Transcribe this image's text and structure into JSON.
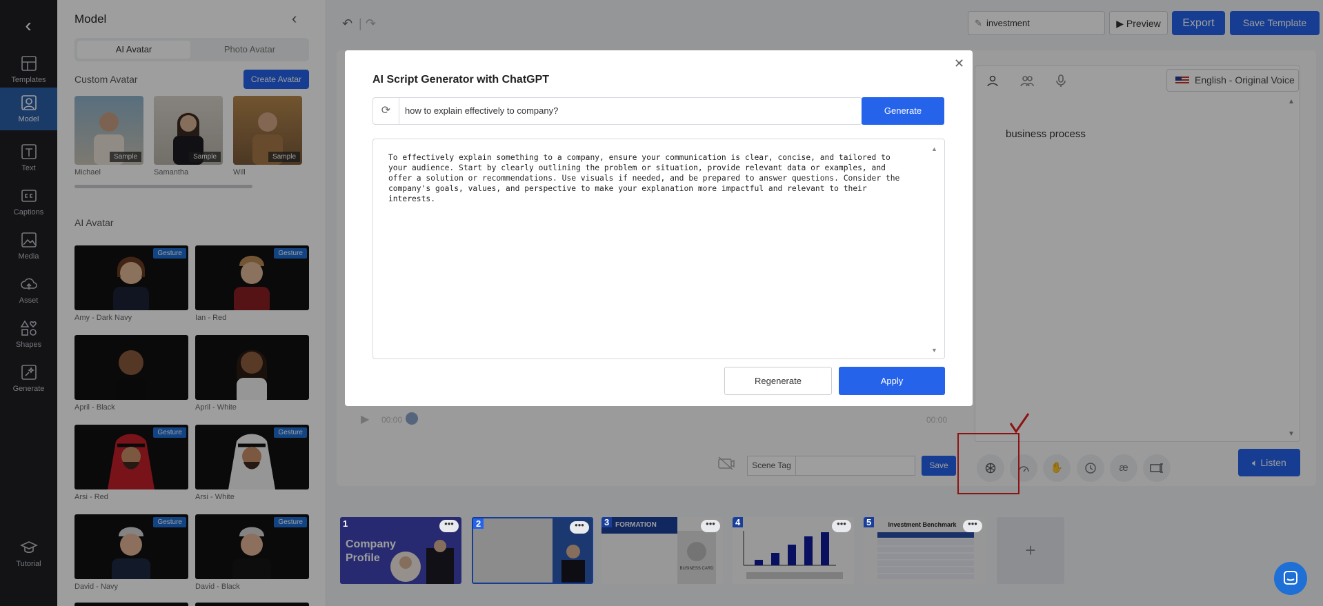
{
  "rail": {
    "items": [
      {
        "label": "Templates",
        "icon": "templates-icon"
      },
      {
        "label": "Model",
        "icon": "model-icon"
      },
      {
        "label": "Text",
        "icon": "text-icon"
      },
      {
        "label": "Captions",
        "icon": "captions-icon"
      },
      {
        "label": "Media",
        "icon": "media-icon"
      },
      {
        "label": "Asset",
        "icon": "asset-icon"
      },
      {
        "label": "Shapes",
        "icon": "shapes-icon"
      },
      {
        "label": "Generate",
        "icon": "generate-icon"
      },
      {
        "label": "Tutorial",
        "icon": "tutorial-icon"
      }
    ]
  },
  "panel": {
    "title": "Model",
    "tabs": [
      "AI Avatar",
      "Photo Avatar"
    ],
    "custom_title": "Custom Avatar",
    "create_label": "Create Avatar",
    "custom": [
      {
        "name": "Michael",
        "tag": "Sample"
      },
      {
        "name": "Samantha",
        "tag": "Sample"
      },
      {
        "name": "Will",
        "tag": "Sample"
      }
    ],
    "ai_title": "AI Avatar",
    "avatars": [
      {
        "name": "Amy - Dark Navy",
        "badge": "Gesture"
      },
      {
        "name": "Ian - Red",
        "badge": "Gesture"
      },
      {
        "name": "April - Black",
        "badge": ""
      },
      {
        "name": "April - White",
        "badge": ""
      },
      {
        "name": "Arsi - Red",
        "badge": "Gesture"
      },
      {
        "name": "Arsi - White",
        "badge": "Gesture"
      },
      {
        "name": "David - Navy",
        "badge": "Gesture"
      },
      {
        "name": "David - Black",
        "badge": "Gesture"
      }
    ]
  },
  "topbar": {
    "search_value": "investment",
    "preview_label": "Preview",
    "export_label": "Export",
    "save_template_label": "Save Template"
  },
  "editor": {
    "language": "English - Original Voice",
    "script_text": "business process",
    "time_start": "00:00",
    "time_end": "00:00",
    "scene_tag_label": "Scene Tag",
    "scene_save_label": "Save",
    "listen_label": "Listen",
    "tool_glyphs": [
      "æ"
    ]
  },
  "timeline": {
    "scenes": [
      {
        "num": "1",
        "title_a": "Company",
        "title_b": "Profile"
      },
      {
        "num": "2"
      },
      {
        "num": "3",
        "title_a": "FORMATION",
        "card": "BUSINESS CARD"
      },
      {
        "num": "4"
      },
      {
        "num": "5",
        "title_a": "Investment Benchmark"
      }
    ],
    "add_label": "+"
  },
  "modal": {
    "title": "AI Script Generator with ChatGPT",
    "prompt": "how to explain effectively to company?",
    "generate_label": "Generate",
    "result": "To effectively explain something to a company, ensure your communication is clear, concise, and tailored to your audience. Start by clearly outlining the problem or situation, provide relevant data or examples, and offer a solution or recommendations. Use visuals if needed, and be prepared to answer questions. Consider the company's goals, values, and perspective to make your explanation more impactful and relevant to their interests.",
    "regenerate_label": "Regenerate",
    "apply_label": "Apply"
  },
  "colors": {
    "accent": "#2563eb",
    "rail_bg": "#1f1f24",
    "highlight": "#e21d1d"
  }
}
